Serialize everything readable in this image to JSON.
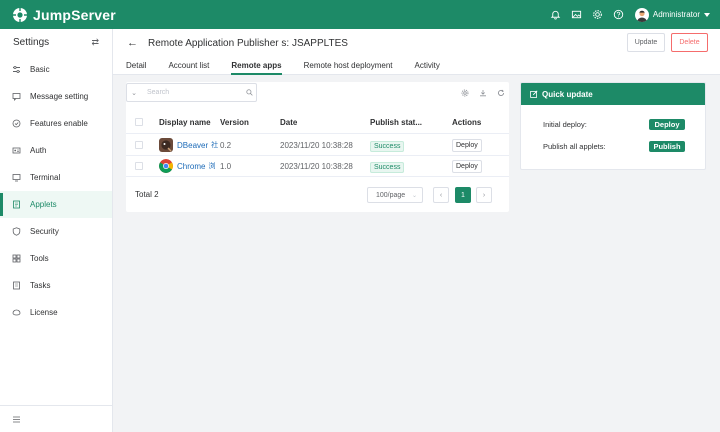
{
  "app": {
    "brand": "JumpServer",
    "user": "Administrator"
  },
  "sidebar": {
    "title": "Settings",
    "items": [
      {
        "label": "Basic",
        "icon": "sliders-icon"
      },
      {
        "label": "Message setting",
        "icon": "message-icon"
      },
      {
        "label": "Features enable",
        "icon": "feature-icon"
      },
      {
        "label": "Auth",
        "icon": "auth-icon"
      },
      {
        "label": "Terminal",
        "icon": "terminal-icon"
      },
      {
        "label": "Applets",
        "icon": "applets-icon",
        "active": true
      },
      {
        "label": "Security",
        "icon": "shield-icon"
      },
      {
        "label": "Tools",
        "icon": "tools-icon"
      },
      {
        "label": "Tasks",
        "icon": "tasks-icon"
      },
      {
        "label": "License",
        "icon": "license-icon"
      }
    ]
  },
  "header": {
    "title": "Remote Application Publisher s: JSAPPLTES",
    "update_label": "Update",
    "delete_label": "Delete",
    "tabs": [
      "Detail",
      "Account list",
      "Remote apps",
      "Remote host deployment",
      "Activity"
    ],
    "active_tab": "Remote apps"
  },
  "table": {
    "search_placeholder": "Search",
    "columns": [
      "Display name",
      "Version",
      "Date",
      "Publish stat...",
      "Actions"
    ],
    "rows": [
      {
        "name": "DBeaver",
        "sub": "社",
        "version": "0.2",
        "date": "2023/11/20 10:38:28",
        "status": "Success",
        "action": "Deploy"
      },
      {
        "name": "Chrome",
        "sub": "浏",
        "version": "1.0",
        "date": "2023/11/20 10:38:28",
        "status": "Success",
        "action": "Deploy"
      }
    ],
    "total": "Total 2",
    "page_size": "100/page",
    "page": "1"
  },
  "quick_update": {
    "title": "Quick update",
    "initial_deploy_label": "Initial deploy:",
    "deploy_button": "Deploy",
    "publish_all_label": "Publish all applets:",
    "publish_button": "Publish"
  },
  "colors": {
    "brand": "#1d8a67",
    "danger": "#f56c6c",
    "link": "#1d6bb8"
  }
}
